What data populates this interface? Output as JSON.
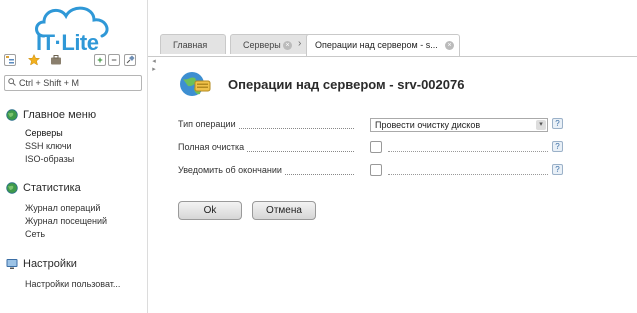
{
  "brand": {
    "logo_text": "IT·Lite",
    "accent_color": "#2f98d7"
  },
  "toolbar": {
    "icons": [
      "tree-icon",
      "star-icon",
      "briefcase-icon",
      "expand-all-icon",
      "collapse-all-icon",
      "pin-icon"
    ],
    "expand_glyph": "+",
    "collapse_glyph": "−"
  },
  "search": {
    "placeholder": "Ctrl + Shift + M"
  },
  "sidebar": {
    "sections": [
      {
        "title": "Главное меню",
        "icon": "globe-icon",
        "items": [
          "Серверы",
          "SSH ключи",
          "ISO-образы"
        ]
      },
      {
        "title": "Статистика",
        "icon": "globe-icon",
        "items": [
          "Журнал операций",
          "Журнал посещений",
          "Сеть"
        ]
      },
      {
        "title": "Настройки",
        "icon": "monitor-icon",
        "items": [
          "Настройки пользоват..."
        ]
      }
    ]
  },
  "tabs": [
    {
      "label": "Главная",
      "closable": false
    },
    {
      "label": "Серверы",
      "closable": true
    },
    {
      "label": "Операции над сервером - s...",
      "closable": true,
      "active": true
    }
  ],
  "tab_arrow": "›",
  "page": {
    "title": "Операции над сервером - srv-002076"
  },
  "form": {
    "operation_type_label": "Тип операции",
    "operation_type_value": "Провести очистку дисков",
    "full_cleanup_label": "Полная очистка",
    "notify_label": "Уведомить об окончании",
    "help_glyph": "?"
  },
  "buttons": {
    "ok": "Ok",
    "cancel": "Отмена"
  }
}
